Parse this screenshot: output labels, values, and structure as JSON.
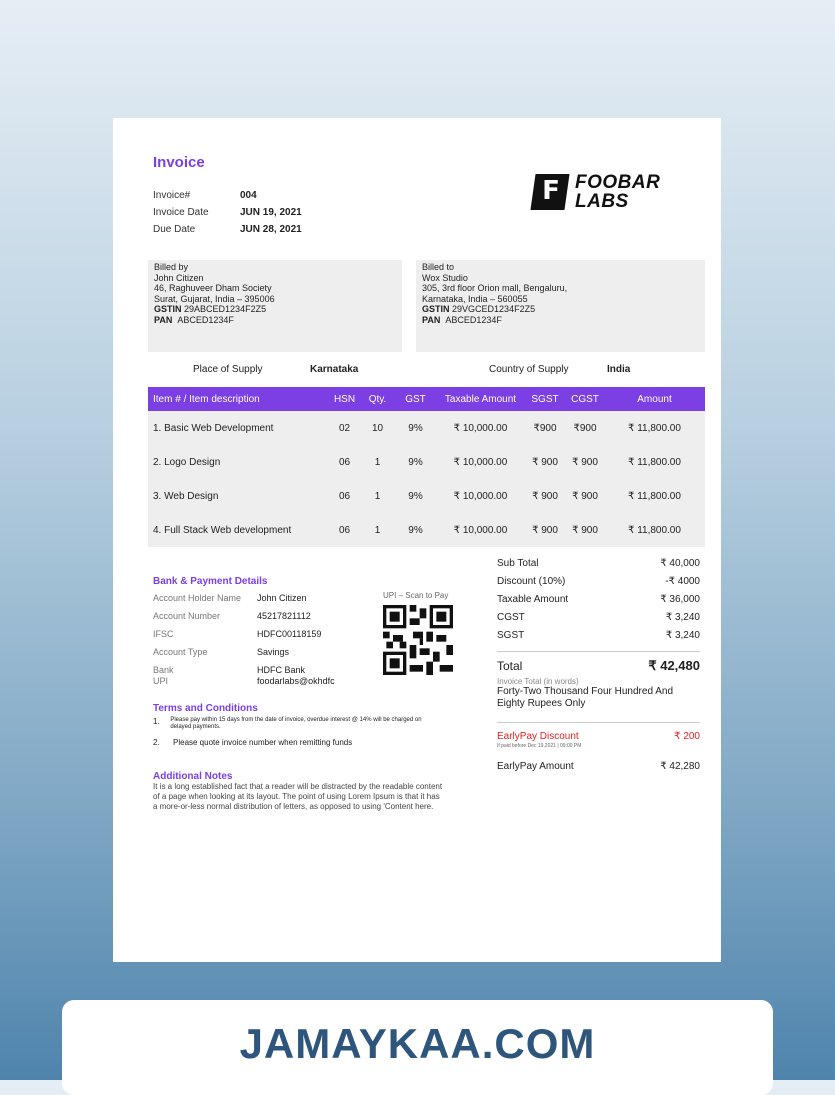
{
  "invoice": {
    "title": "Invoice",
    "number_label": "Invoice#",
    "number": "004",
    "date_label": "Invoice Date",
    "date": "JUN 19, 2021",
    "due_label": "Due Date",
    "due": "JUN 28, 2021"
  },
  "logo": {
    "mark": "F",
    "line1": "FOOBAR",
    "line2": "LABS"
  },
  "billed_by": {
    "heading": "Billed by",
    "name": "John Citizen",
    "address1": "46, Raghuveer Dham Society",
    "address2": "Surat, Gujarat, India – 395006",
    "gstin_label": "GSTIN",
    "gstin": "29ABCED1234F2Z5",
    "pan_label": "PAN",
    "pan": "ABCED1234F"
  },
  "billed_to": {
    "heading": "Billed to",
    "name": "Wox Studio",
    "address1": "305, 3rd floor Orion mall, Bengaluru,",
    "address2": "Karnataka, India – 560055",
    "gstin_label": "GSTIN",
    "gstin": "29VGCED1234F2Z5",
    "pan_label": "PAN",
    "pan": "ABCED1234F"
  },
  "supply": {
    "place_label": "Place of Supply",
    "place": "Karnataka",
    "country_label": "Country of Supply",
    "country": "India"
  },
  "table": {
    "headers": [
      "Item # / Item description",
      "HSN",
      "Qty.",
      "GST",
      "Taxable Amount",
      "SGST",
      "CGST",
      "Amount"
    ],
    "rows": [
      [
        "1. Basic Web Development",
        "02",
        "10",
        "9%",
        "₹ 10,000.00",
        "₹900",
        "₹900",
        "₹ 11,800.00"
      ],
      [
        "2. Logo Design",
        "06",
        "1",
        "9%",
        "₹ 10,000.00",
        "₹ 900",
        "₹ 900",
        "₹ 11,800.00"
      ],
      [
        "3. Web Design",
        "06",
        "1",
        "9%",
        "₹ 10,000.00",
        "₹ 900",
        "₹ 900",
        "₹ 11,800.00"
      ],
      [
        "4. Full Stack Web development",
        "06",
        "1",
        "9%",
        "₹ 10,000.00",
        "₹ 900",
        "₹ 900",
        "₹ 11,800.00"
      ]
    ]
  },
  "bank": {
    "title": "Bank & Payment Details",
    "holder_label": "Account Holder Name",
    "holder": "John Citizen",
    "number_label": "Account Number",
    "number": "45217821112",
    "ifsc_label": "IFSC",
    "ifsc": "HDFC00118159",
    "type_label": "Account Type",
    "type": "Savings",
    "bank_label": "Bank",
    "bank": "HDFC Bank",
    "upi_label": "UPI",
    "upi": "foodarlabs@okhdfc",
    "qr_label": "UPI – Scan to Pay"
  },
  "terms": {
    "title": "Terms and Conditions",
    "items": [
      {
        "n": "1.",
        "text": "Please pay within 15 days from the date of invoice, overdue interest @ 14% will be charged on delayed payments."
      },
      {
        "n": "2.",
        "text": "Please quote invoice number when remitting funds"
      }
    ]
  },
  "notes": {
    "title": "Additional Notes",
    "text": "It is a long established fact that a reader will be distracted by the readable content of a page when looking at its layout. The point of using Lorem Ipsum is that it has a more-or-less normal distribution of letters, as opposed to using 'Content here."
  },
  "totals": {
    "subtotal_label": "Sub Total",
    "subtotal": "₹ 40,000",
    "discount_label": "Discount (10%)",
    "discount": "-₹ 4000",
    "taxable_label": "Taxable Amount",
    "taxable": "₹ 36,000",
    "cgst_label": "CGST",
    "cgst": "₹ 3,240",
    "sgst_label": "SGST",
    "sgst": "₹ 3,240",
    "total_label": "Total",
    "total": "₹ 42,480",
    "words_label": "Invoice Total (in words)",
    "words": "Forty-Two Thousand Four Hundred And Eighty Rupees Only",
    "early_discount_label": "EarlyPay Discount",
    "early_discount": "₹ 200",
    "early_note": "If paid before Dec 19,2021 | 09:00 PM",
    "early_amount_label": "EarlyPay Amount",
    "early_amount": "₹ 42,280"
  },
  "banner": {
    "text": "JAMAYKAA.COM"
  },
  "colors": {
    "accent": "#7b3fe4",
    "banner_text": "#2e567c",
    "early": "#e02020"
  }
}
